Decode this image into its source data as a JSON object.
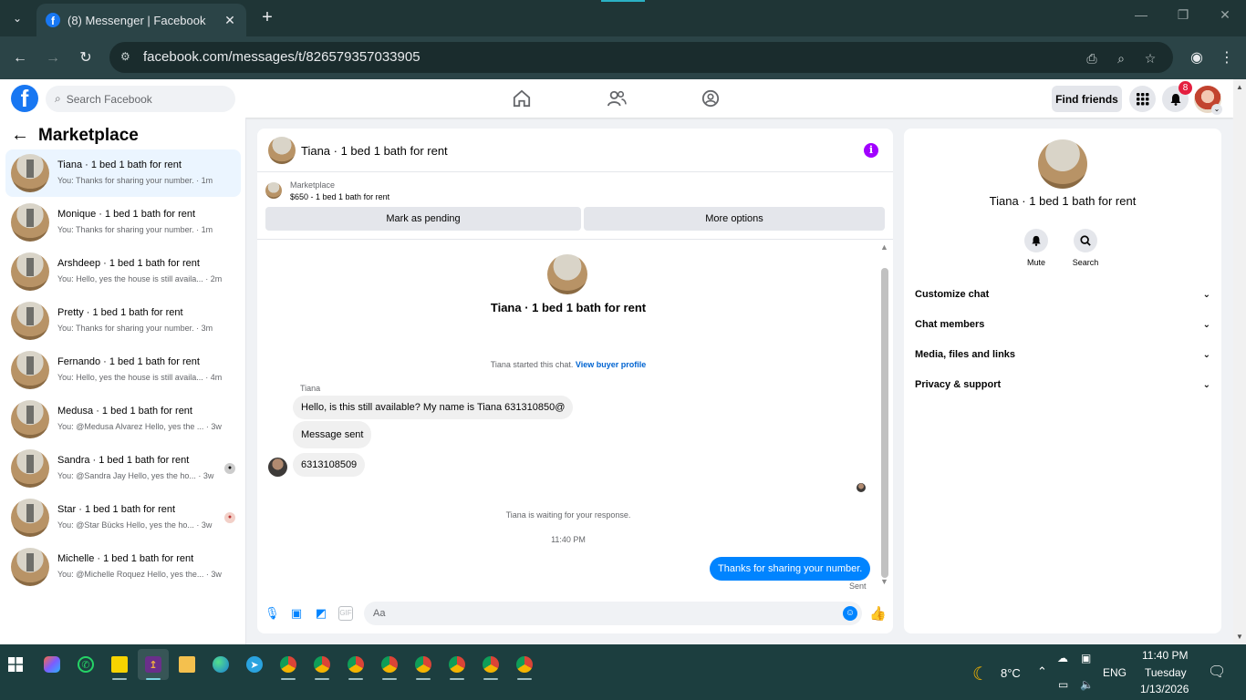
{
  "browser": {
    "tab_title": "(8) Messenger | Facebook",
    "url": "facebook.com/messages/t/826579357033905"
  },
  "fb": {
    "search_placeholder": "Search Facebook",
    "find_friends": "Find friends",
    "notification_count": "8"
  },
  "left": {
    "title": "Marketplace",
    "conversations": [
      {
        "name": "Tiana · 1 bed 1 bath for rent",
        "preview": "You: Thanks for sharing your number. · 1m"
      },
      {
        "name": "Monique · 1 bed 1 bath for rent",
        "preview": "You: Thanks for sharing your number. · 1m"
      },
      {
        "name": "Arshdeep · 1 bed 1 bath for rent",
        "preview": "You: Hello, yes the house is still availa... · 2m"
      },
      {
        "name": "Pretty · 1 bed 1 bath for rent",
        "preview": "You: Thanks for sharing your number. · 3m"
      },
      {
        "name": "Fernando · 1 bed 1 bath for rent",
        "preview": "You: Hello, yes the house is still availa... · 4m"
      },
      {
        "name": "Medusa · 1 bed 1 bath for rent",
        "preview": "You: @Medusa Alvarez Hello, yes the ... · 3w"
      },
      {
        "name": "Sandra · 1 bed 1 bath for rent",
        "preview": "You: @Sandra Jay Hello, yes the ho... · 3w"
      },
      {
        "name": "Star · 1 bed 1 bath for rent",
        "preview": "You: @Star Bücks Hello, yes the ho... · 3w"
      },
      {
        "name": "Michelle · 1 bed 1 bath for rent",
        "preview": "You: @Michelle Roquez Hello, yes the... · 3w"
      }
    ]
  },
  "chat": {
    "header_name": "Tiana · 1 bed 1 bath for rent",
    "marketplace_label": "Marketplace",
    "listing": "$650 - 1 bed 1 bath for rent",
    "mark_pending": "Mark as pending",
    "more_options": "More options",
    "thread_title": "Tiana · 1 bed 1 bath for rent",
    "started_text": "Tiana started this chat. ",
    "view_buyer": "View buyer profile",
    "sender": "Tiana",
    "messages_in": [
      "Hello, is this still available? My name is Tiana 631310850@",
      "Message sent",
      "6313108509"
    ],
    "waiting": "Tiana is waiting for your response.",
    "time": "11:40 PM",
    "message_out": "Thanks for sharing your number.",
    "sent_label": "Sent",
    "composer_placeholder": "Aa"
  },
  "right": {
    "name": "Tiana · 1 bed 1 bath for rent",
    "mute": "Mute",
    "search": "Search",
    "sections": [
      "Customize chat",
      "Chat members",
      "Media, files and links",
      "Privacy & support"
    ]
  },
  "taskbar": {
    "weather": "8°C",
    "lang": "ENG",
    "time": "11:40 PM",
    "day": "Tuesday",
    "date": "1/13/2026"
  },
  "colors": {
    "fb_blue": "#1877f2",
    "messenger_blue": "#0084ff",
    "info_purple": "#a100ff",
    "active_row": "#ebf5ff"
  }
}
